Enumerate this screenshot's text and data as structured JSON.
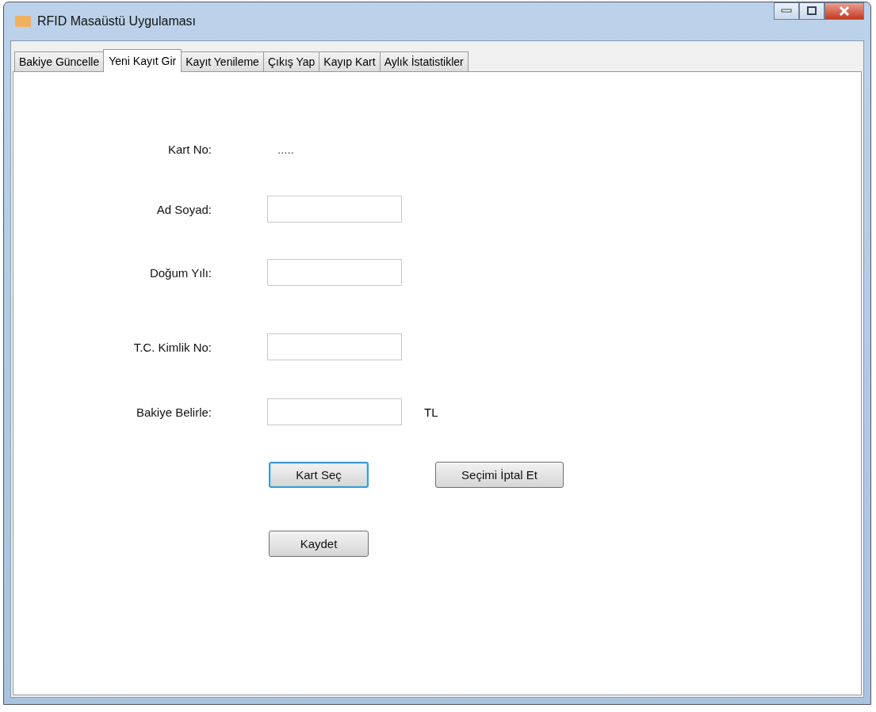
{
  "window": {
    "title": "RFID Masaüstü Uygulaması"
  },
  "tabs": [
    {
      "label": "Bakiye Güncelle",
      "selected": false
    },
    {
      "label": "Yeni Kayıt Gir",
      "selected": true
    },
    {
      "label": "Kayıt Yenileme",
      "selected": false
    },
    {
      "label": "Çıkış Yap",
      "selected": false
    },
    {
      "label": "Kayıp Kart",
      "selected": false
    },
    {
      "label": "Aylık İstatistikler",
      "selected": false
    }
  ],
  "fields": [
    {
      "kind": "value",
      "label": "Kart No:",
      "value": "....."
    },
    {
      "kind": "input",
      "label": "Ad Soyad:"
    },
    {
      "kind": "input",
      "label": "Doğum Yılı:"
    },
    {
      "kind": "input",
      "label": "T.C. Kimlik No:"
    },
    {
      "kind": "input",
      "label": "Bakiye Belirle:",
      "suffix": "TL"
    }
  ],
  "buttons": [
    {
      "label": "Kart Seç",
      "focused": true
    },
    {
      "label": "Seçimi İptal Et",
      "focused": false
    },
    {
      "label": "Kaydet",
      "focused": false
    }
  ]
}
